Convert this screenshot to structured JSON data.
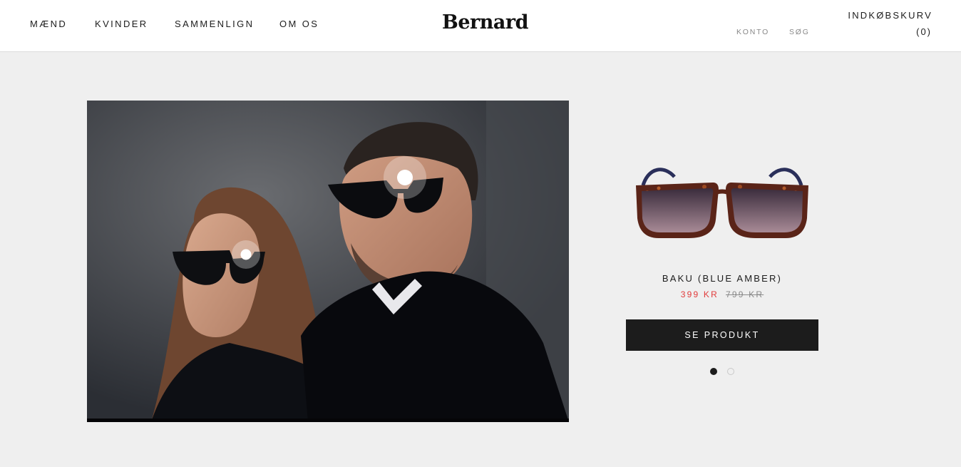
{
  "header": {
    "nav": [
      "MÆND",
      "KVINDER",
      "SAMMENLIGN",
      "OM OS"
    ],
    "logo": "Bernard",
    "account_label": "KONTO",
    "search_label": "SØG",
    "cart_label": "INDKØBSKURV",
    "cart_count": "(0)"
  },
  "hero": {
    "hotspots": 2
  },
  "product": {
    "name": "BAKU (BLUE AMBER)",
    "sale_price": "399 KR",
    "old_price": "799 KR",
    "cta_label": "SE PRODUKT"
  },
  "slider": {
    "total": 2,
    "active": 1
  },
  "colors": {
    "background": "#efefef",
    "header": "#ffffff",
    "text": "#1c1c1c",
    "sale": "#e13a3a",
    "button": "#1c1c1c"
  }
}
